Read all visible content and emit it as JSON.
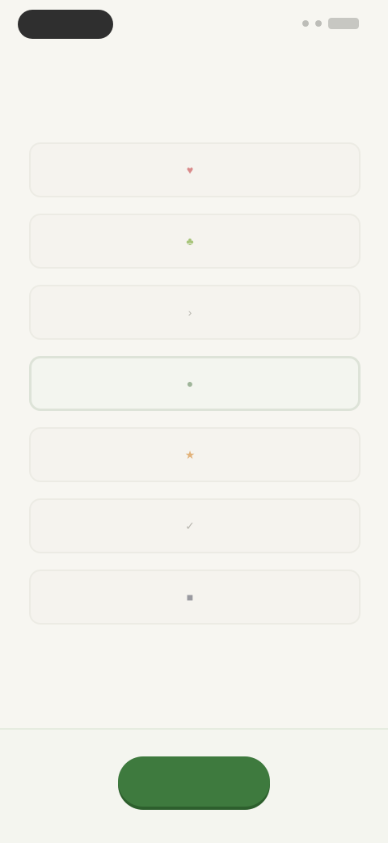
{
  "status_bar": {
    "icons": [
      "signal-icon",
      "wifi-icon",
      "battery-icon"
    ]
  },
  "question": {
    "text": ""
  },
  "options": [
    {
      "label": "",
      "icon": "heart-icon",
      "color": "#d98a8a"
    },
    {
      "label": "",
      "icon": "leaf-icon",
      "color": "#a7c47a"
    },
    {
      "label": "",
      "icon": "arrow-icon",
      "color": "#b7b5ae"
    },
    {
      "label": "",
      "icon": "people-icon",
      "color": "#9fb59a",
      "selected": true
    },
    {
      "label": "",
      "icon": "star-icon",
      "color": "#e2b27a"
    },
    {
      "label": "",
      "icon": "check-icon",
      "color": "#b7b5ae"
    },
    {
      "label": "",
      "icon": "book-icon",
      "color": "#9a9aa0"
    }
  ],
  "continue_button": {
    "label": "",
    "color": "#3e7a3e"
  }
}
